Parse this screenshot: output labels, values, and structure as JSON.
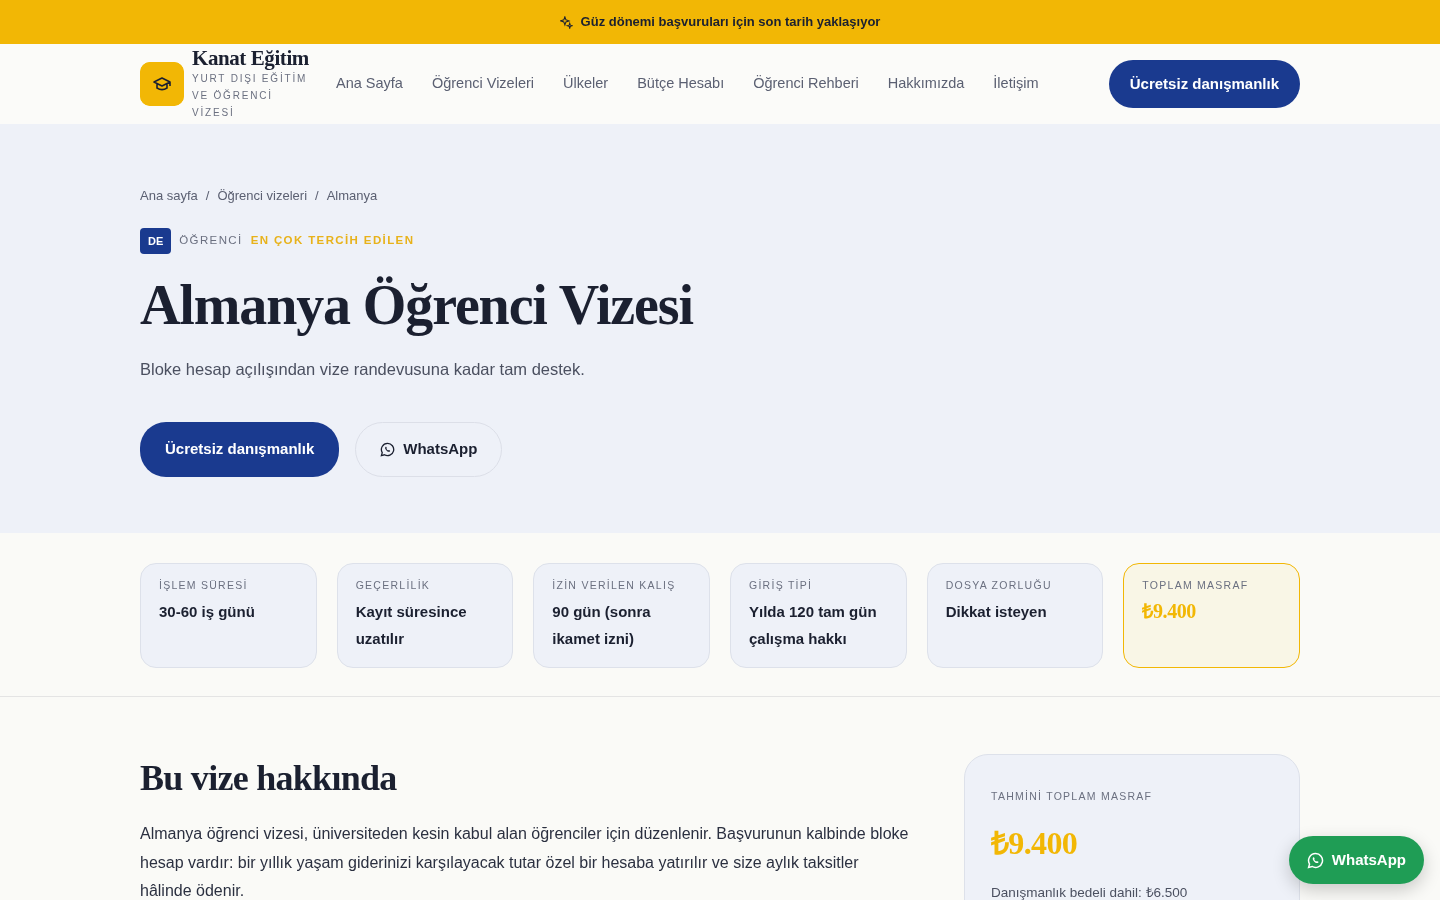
{
  "announcement": {
    "text": "Güz dönemi başvuruları için son tarih yaklaşıyor"
  },
  "brand": {
    "name": "Kanat Eğitim",
    "tagline": "YURT DIŞI EĞİTİM VE ÖĞRENCİ VİZESİ"
  },
  "nav": {
    "items": [
      "Ana Sayfa",
      "Öğrenci Vizeleri",
      "Ülkeler",
      "Bütçe Hesabı",
      "Öğrenci Rehberi",
      "Hakkımızda",
      "İletişim"
    ],
    "cta": "Ücretsiz danışmanlık"
  },
  "breadcrumb": [
    "Ana sayfa",
    "Öğrenci vizeleri",
    "Almanya"
  ],
  "breadcrumb_separator": "/",
  "hero": {
    "country_code": "DE",
    "category": "ÖĞRENCİ",
    "tag": "EN ÇOK TERCİH EDİLEN",
    "title": "Almanya Öğrenci Vizesi",
    "subtitle": "Bloke hesap açılışından vize randevusuna kadar tam destek.",
    "primary_button": "Ücretsiz danışmanlık",
    "secondary_button": "WhatsApp"
  },
  "stats": [
    {
      "label": "İŞLEM SÜRESİ",
      "value": "30-60 iş günü",
      "highlighted": false
    },
    {
      "label": "GEÇERLİLİK",
      "value": "Kayıt süresince uzatılır",
      "highlighted": false
    },
    {
      "label": "İZİN VERİLEN KALIŞ",
      "value": "90 gün (sonra ikamet izni)",
      "highlighted": false
    },
    {
      "label": "GİRİŞ TİPİ",
      "value": "Yılda 120 tam gün çalışma hakkı",
      "highlighted": false
    },
    {
      "label": "DOSYA ZORLUĞU",
      "value": "Dikkat isteyen",
      "highlighted": false
    },
    {
      "label": "TOPLAM MASRAF",
      "value": "₺9.400",
      "highlighted": true
    }
  ],
  "about": {
    "heading": "Bu vize hakkında",
    "text": "Almanya öğrenci vizesi, üniversiteden kesin kabul alan öğrenciler için düzenlenir. Başvurunun kalbinde bloke hesap vardır: bir yıllık yaşam giderinizi karşılayacak tutar özel bir hesaba yatırılır ve size aylık taksitler hâlinde ödenir."
  },
  "cost_card": {
    "label": "TAHMİNİ TOPLAM MASRAF",
    "amount": "₺9.400",
    "note": "Danışmanlık bedeli dahil: ₺6.500"
  },
  "floating_button": {
    "label": "WhatsApp"
  }
}
